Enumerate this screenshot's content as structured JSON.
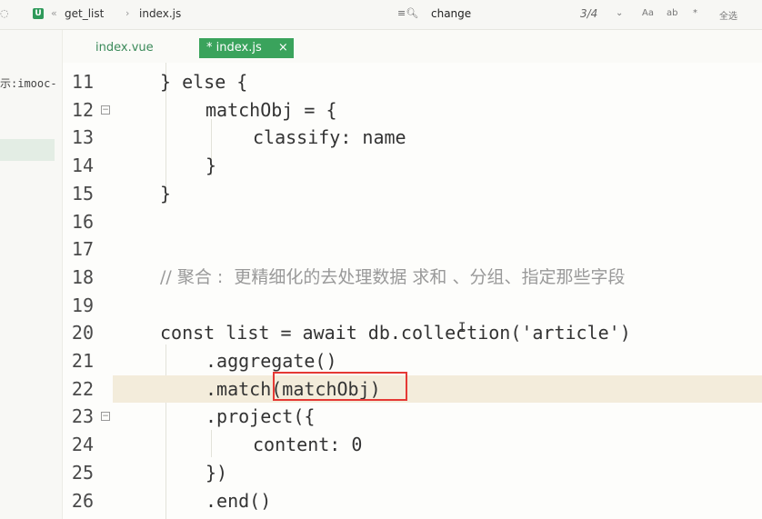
{
  "topbar": {
    "breadcrumb": [
      "get_list",
      "index.js"
    ],
    "find_text": "change",
    "find_count": "3/4",
    "options": [
      "Aa",
      "ab",
      "*"
    ],
    "select_all": "全选"
  },
  "sidebar": {
    "project_label": "示:imooc-"
  },
  "tabs": [
    {
      "label": "index.vue",
      "active": false
    },
    {
      "label": "* index.js",
      "active": true,
      "close": "×"
    }
  ],
  "editor": {
    "lines": [
      {
        "n": "11",
        "text": "} else {"
      },
      {
        "n": "12",
        "text": "matchObj = {"
      },
      {
        "n": "13",
        "text": "classify: name"
      },
      {
        "n": "14",
        "text": "}"
      },
      {
        "n": "15",
        "text": "}"
      },
      {
        "n": "16",
        "text": ""
      },
      {
        "n": "17",
        "text": ""
      },
      {
        "n": "18",
        "text": "// 聚合 :  更精细化的去处理数据 求和 、分组、指定那些字段"
      },
      {
        "n": "19",
        "text": ""
      },
      {
        "n": "20",
        "text": "const list = await db.collection('article')"
      },
      {
        "n": "21",
        "text": ".aggregate()"
      },
      {
        "n": "22",
        "text": ".match(matchObj)"
      },
      {
        "n": "23",
        "text": ".project({"
      },
      {
        "n": "24",
        "text": "content: 0"
      },
      {
        "n": "25",
        "text": "})"
      },
      {
        "n": "26",
        "text": ".end()"
      }
    ]
  },
  "colors": {
    "accent": "#3aa35c",
    "highlight_box": "#e53935",
    "current_line": "#f3ecdb"
  }
}
